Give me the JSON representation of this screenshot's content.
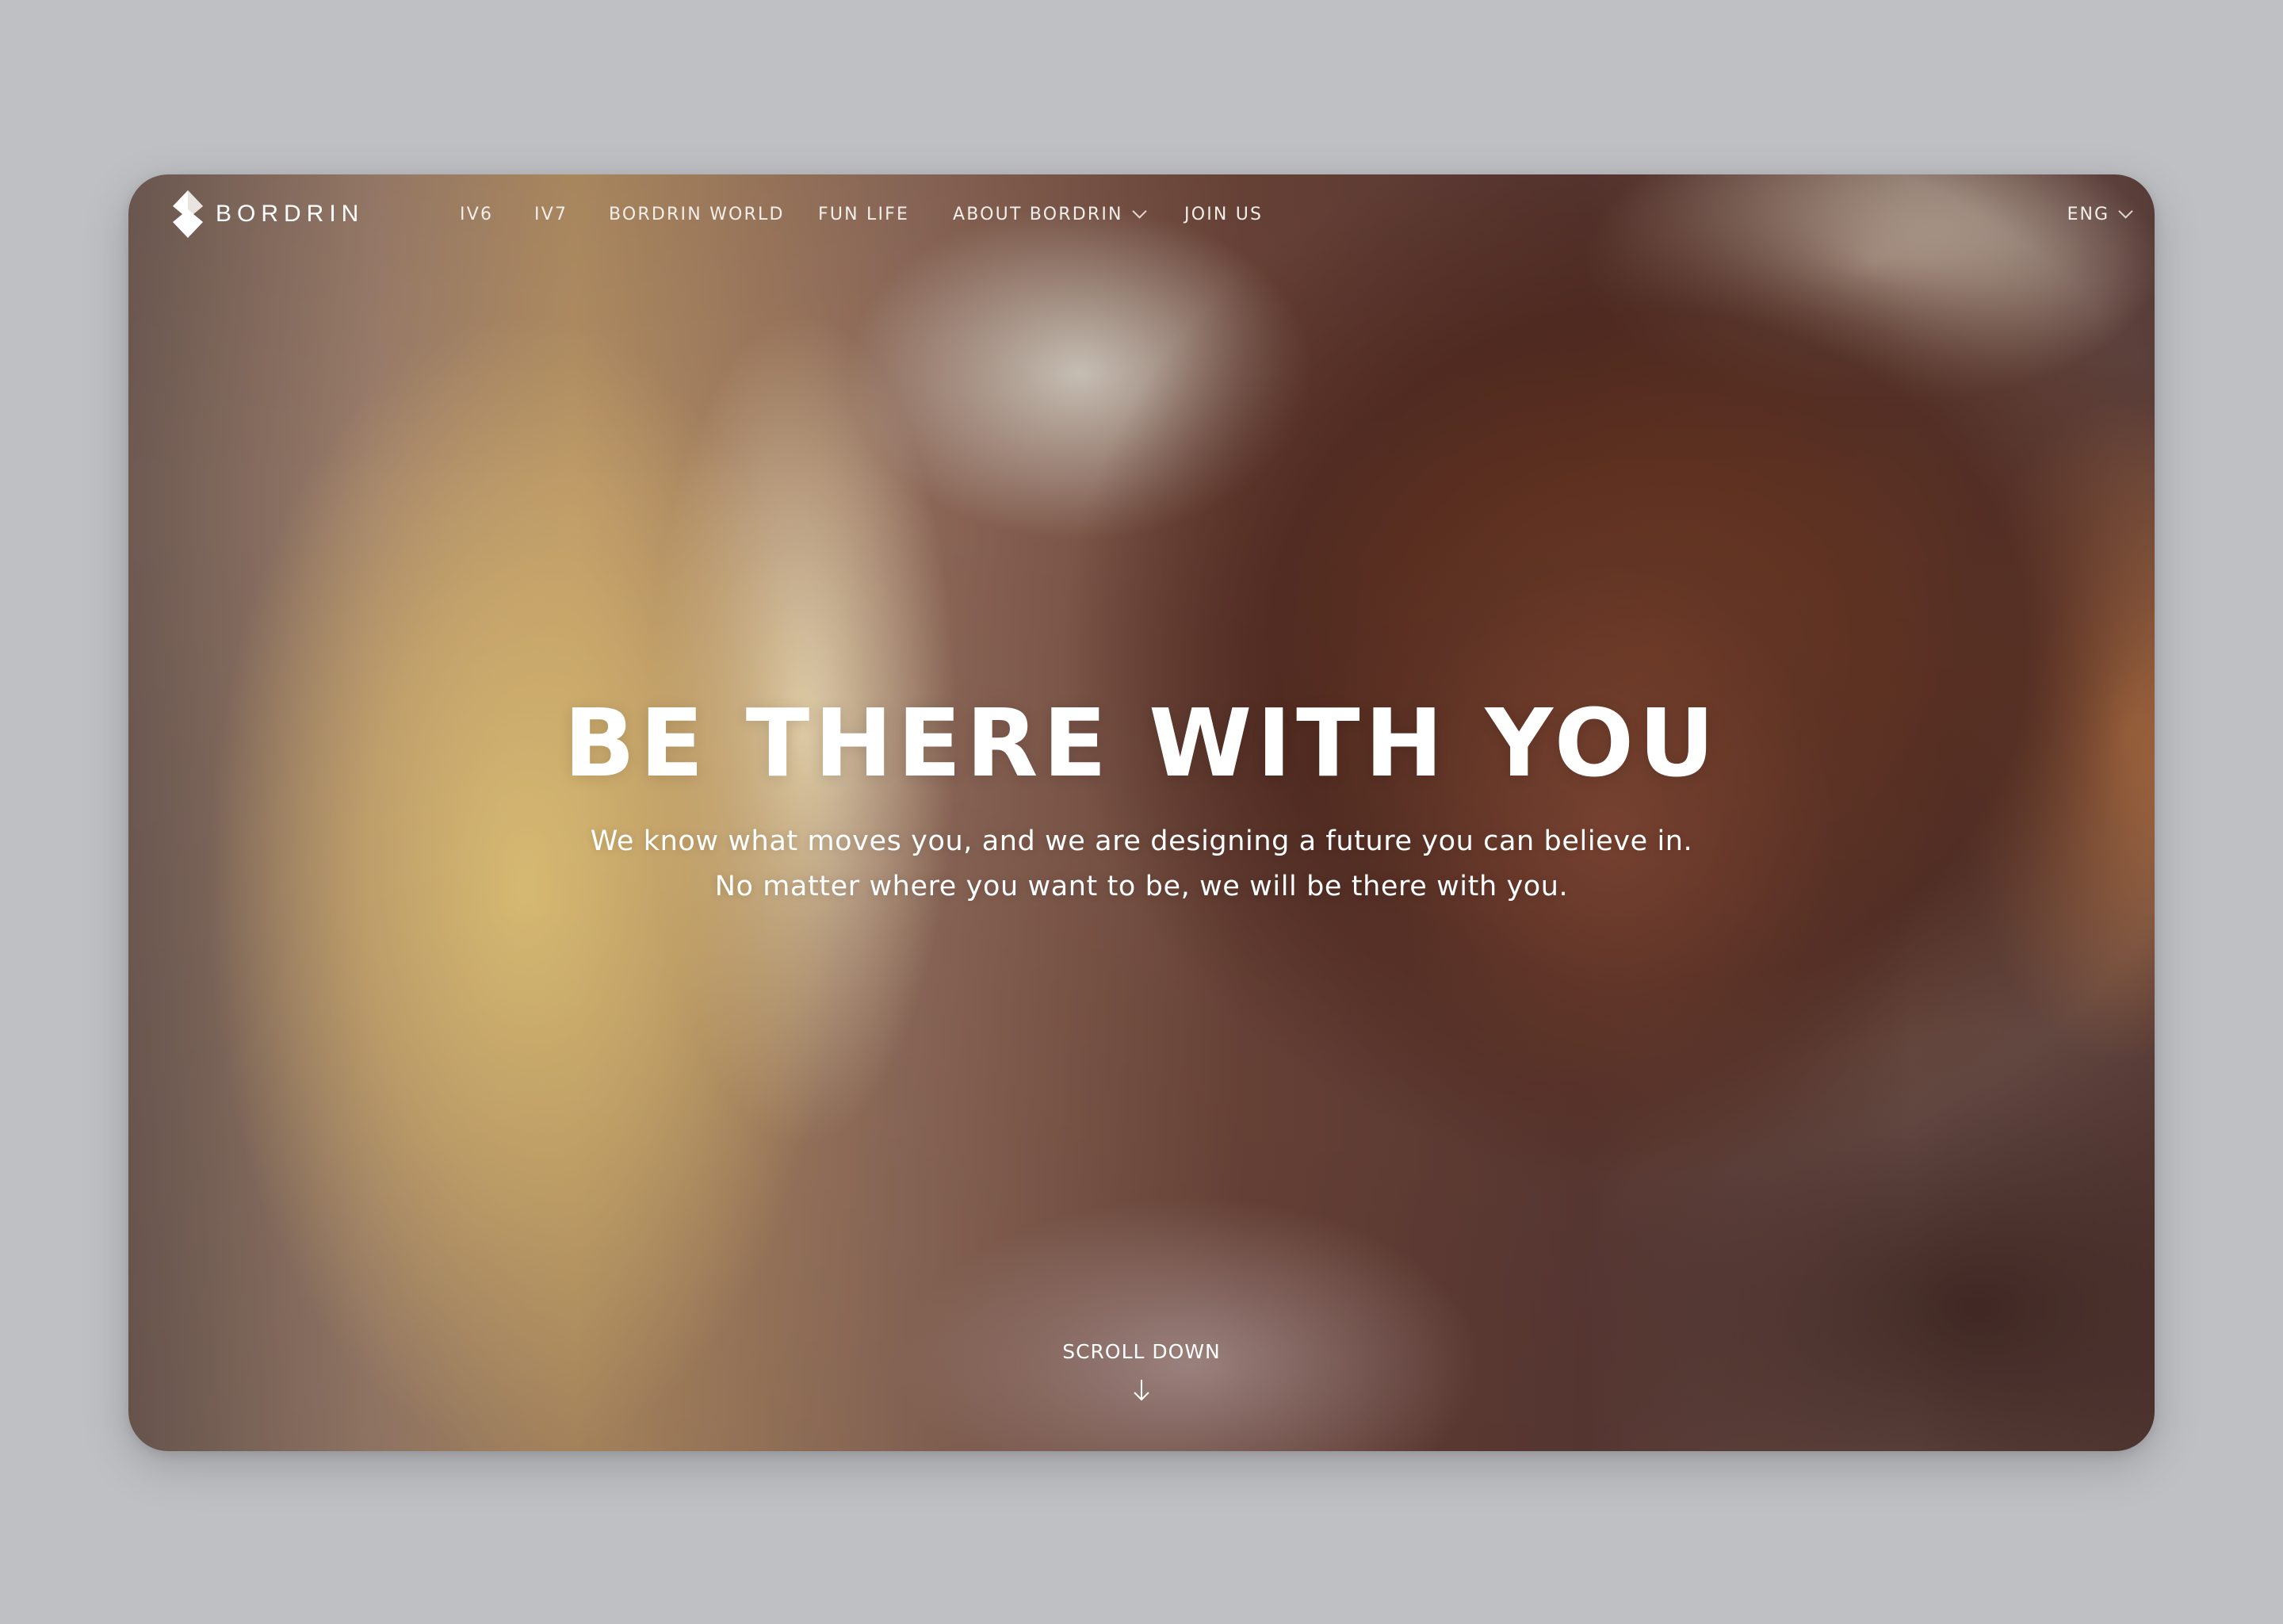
{
  "brand": {
    "name": "BORDRIN",
    "logo_icon": "bordrin-diamond-logo"
  },
  "nav": {
    "items": [
      {
        "label": "IV6"
      },
      {
        "label": "IV7"
      },
      {
        "label": "BORDRIN WORLD"
      },
      {
        "label": "FUN LIFE"
      },
      {
        "label": "ABOUT BORDRIN",
        "icon": "chevron-down-icon"
      },
      {
        "label": "JOIN US"
      }
    ],
    "language": {
      "label": "ENG",
      "icon": "chevron-down-icon"
    }
  },
  "hero": {
    "headline": "BE THERE WITH YOU",
    "subline_1": "We know what moves you, and we are designing a future you can believe in.",
    "subline_2": "No matter where you want to be, we will be there with you.",
    "scroll_label": "SCROLL DOWN",
    "scroll_icon": "arrow-down-icon"
  },
  "colors": {
    "page_background": "#bfc0c4",
    "text": "#ffffff"
  }
}
